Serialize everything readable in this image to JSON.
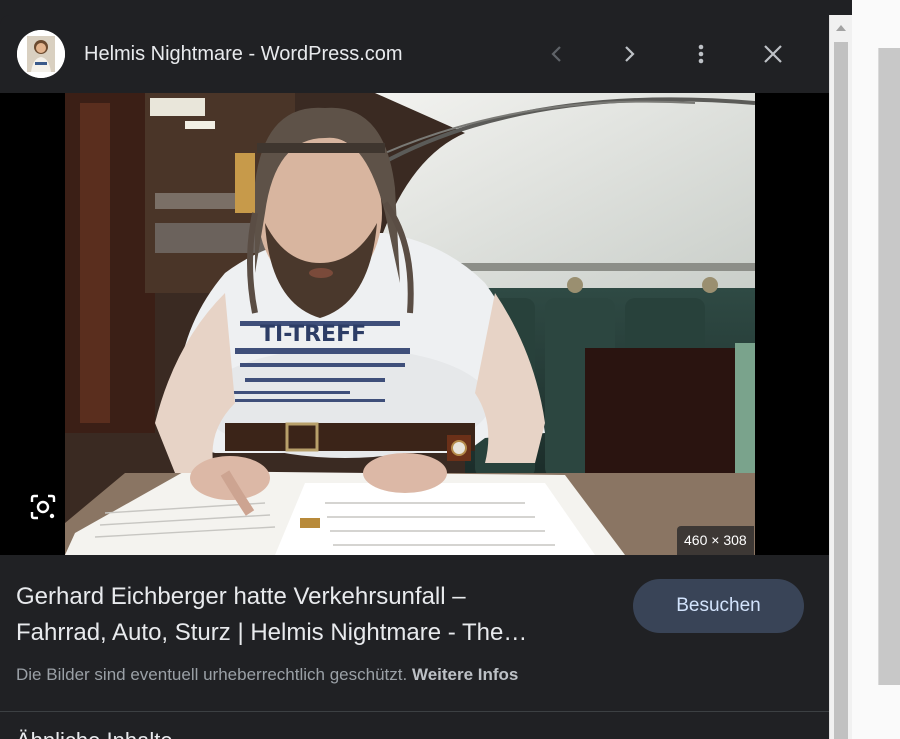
{
  "header": {
    "site_name": "Helmis Nightmare - WordPress.com",
    "favicon_icon": "site-favicon",
    "prev_icon": "chevron-left-icon",
    "next_icon": "chevron-right-icon",
    "more_icon": "more-vert-icon",
    "close_icon": "close-icon"
  },
  "image": {
    "dimensions": "460 × 308",
    "lens_icon": "lens-search-icon",
    "shirt_text": "TI-TREFF"
  },
  "result": {
    "title_line1": "Gerhard Eichberger hatte Verkehrsunfall –",
    "title_line2": "Fahrrad, Auto, Sturz | Helmis Nightmare - The…",
    "visit_label": "Besuchen"
  },
  "copyright": {
    "text": "Die Bilder sind eventuell urheberrechtlich geschützt.",
    "link": "Weitere Infos"
  },
  "next_section": {
    "heading": "Ähnliche Inhalte"
  },
  "colors": {
    "panel_bg": "#202124",
    "button_bg": "#394457",
    "button_text": "#d2e3fc",
    "text_primary": "#e8eaed",
    "text_secondary": "#9aa0a6"
  }
}
